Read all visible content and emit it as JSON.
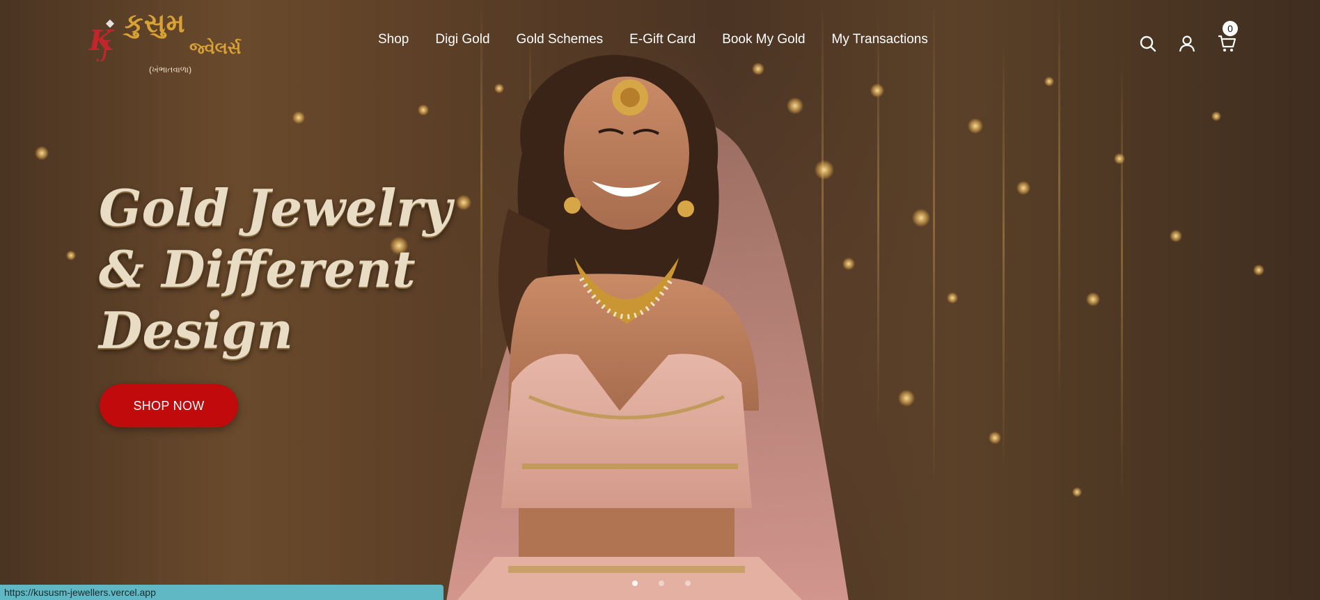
{
  "brand": {
    "name": "કુસુમ",
    "sub": "જ્વેલર્સ",
    "tagline": "(ખંભાતવાળા)",
    "monogram": "KJ"
  },
  "nav": {
    "items": [
      "Shop",
      "Digi Gold",
      "Gold Schemes",
      "E-Gift Card",
      "Book My Gold",
      "My Transactions"
    ]
  },
  "header_icons": {
    "search": "search-icon",
    "account": "user-icon",
    "cart": "cart-icon",
    "cart_count": "0"
  },
  "hero": {
    "headline_lines": [
      "Gold Jewelry",
      "& Different",
      "Design"
    ],
    "cta_label": "SHOP NOW",
    "slides": 3,
    "active_slide": 1
  },
  "status_bar": {
    "url": "https://kususm-jewellers.vercel.app"
  },
  "colors": {
    "accent_red": "#c10a0c",
    "logo_gold": "#d8a236",
    "headline": "#e9dcc4"
  }
}
